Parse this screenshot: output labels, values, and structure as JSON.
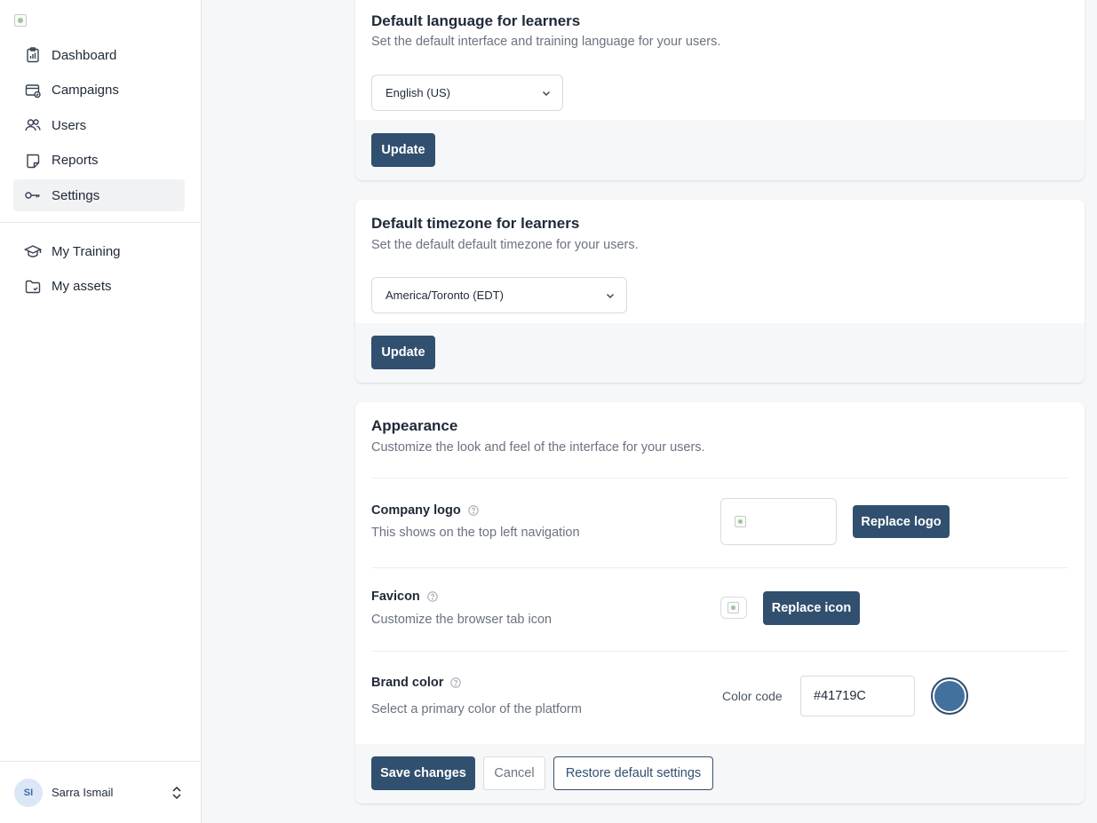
{
  "sidebar": {
    "nav": [
      {
        "label": "Dashboard",
        "icon": "dashboard-icon"
      },
      {
        "label": "Campaigns",
        "icon": "campaigns-icon"
      },
      {
        "label": "Users",
        "icon": "users-icon"
      },
      {
        "label": "Reports",
        "icon": "reports-icon"
      },
      {
        "label": "Settings",
        "icon": "settings-icon",
        "active": true
      }
    ],
    "nav_secondary": [
      {
        "label": "My Training",
        "icon": "graduation-cap-icon"
      },
      {
        "label": "My assets",
        "icon": "folder-icon"
      }
    ],
    "user": {
      "initials": "SI",
      "name": "Sarra Ismail"
    }
  },
  "language_card": {
    "title": "Default language for learners",
    "subtitle": "Set the default interface and training language for your users.",
    "selected": "English (US)",
    "button": "Update"
  },
  "timezone_card": {
    "title": "Default timezone for learners",
    "subtitle": "Set the default default timezone for your users.",
    "selected": "America/Toronto (EDT)",
    "button": "Update"
  },
  "appearance_card": {
    "title": "Appearance",
    "subtitle": "Customize the look and feel of the interface for your users.",
    "logo": {
      "label": "Company logo",
      "description": "This shows on the top left navigation",
      "button": "Replace logo"
    },
    "favicon": {
      "label": "Favicon",
      "description": "Customize the browser tab icon",
      "button": "Replace icon"
    },
    "brand": {
      "label": "Brand color",
      "description": "Select a primary color of the platform",
      "color_label": "Color code",
      "color_value": "#41719C"
    },
    "footer": {
      "save": "Save changes",
      "cancel": "Cancel",
      "restore": "Restore default settings"
    }
  },
  "colors": {
    "primary_button": "#31506f",
    "brand_swatch": "#41719C",
    "active_nav_bg": "#f1f2f4"
  }
}
